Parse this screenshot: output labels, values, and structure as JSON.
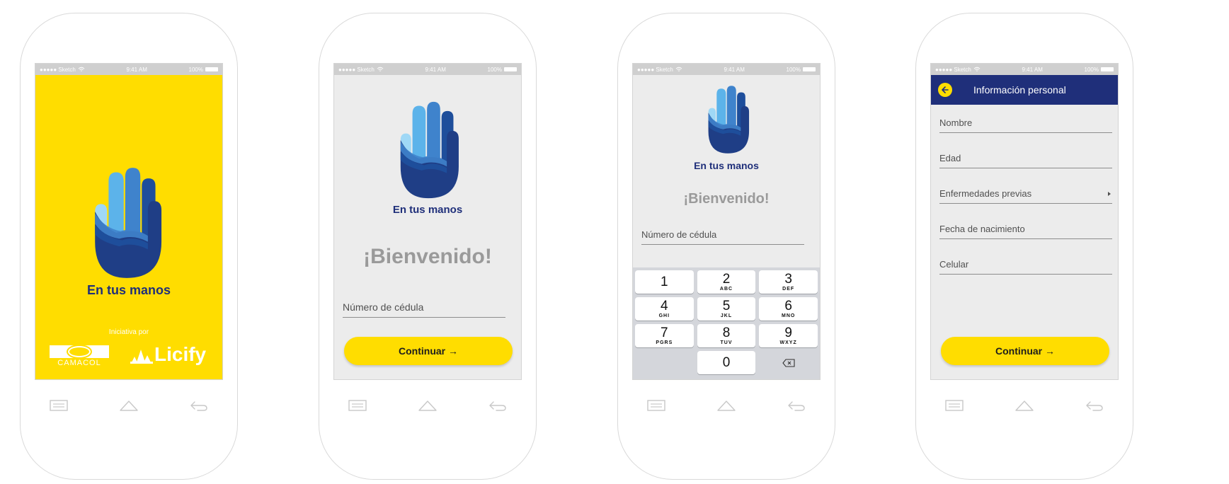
{
  "status_bar": {
    "carrier": "●●●●● Sketch",
    "time": "9:41 AM",
    "battery": "100%"
  },
  "brand": {
    "name": "En tus manos"
  },
  "colors": {
    "yellow": "#ffdd00",
    "navy": "#1f2f7a",
    "screen_gray": "#ececec",
    "hand_light": "#9fd8f6",
    "hand_mid": "#5cb3ea",
    "hand_blue": "#3f83cc",
    "hand_dark": "#1e4e9b",
    "hand_darkest": "#1f3e86"
  },
  "splash": {
    "initiative_label": "Iniciativa por",
    "partner_1": "CAMACOL",
    "partner_2": "Licify"
  },
  "welcome_screen": {
    "title": "¡Bienvenido!",
    "id_placeholder": "Número de cédula",
    "continue_label": "Continuar →"
  },
  "keypad": {
    "keys": [
      {
        "num": "1",
        "letters": ""
      },
      {
        "num": "2",
        "letters": "ABC"
      },
      {
        "num": "3",
        "letters": "DEF"
      },
      {
        "num": "4",
        "letters": "GHI"
      },
      {
        "num": "5",
        "letters": "JKL"
      },
      {
        "num": "6",
        "letters": "MNO"
      },
      {
        "num": "7",
        "letters": "PGRS"
      },
      {
        "num": "8",
        "letters": "TUV"
      },
      {
        "num": "9",
        "letters": "WXYZ"
      },
      {
        "num": "",
        "letters": ""
      },
      {
        "num": "0",
        "letters": ""
      },
      {
        "num": "⌫",
        "letters": ""
      }
    ]
  },
  "personal_info": {
    "title": "Información personal",
    "fields": {
      "name": "Nombre",
      "age": "Edad",
      "conditions": "Enfermedades previas",
      "birthdate": "Fecha de nacimiento",
      "phone": "Celular"
    },
    "continue_label": "Continuar →"
  },
  "icons": {
    "menu": "menu-icon",
    "home": "home-icon",
    "back": "back-arrow-icon",
    "wifi": "wifi-icon",
    "battery": "battery-icon",
    "backspace": "backspace-icon",
    "chevron": "chevron-right-icon",
    "hand": "hand-logo-icon"
  }
}
